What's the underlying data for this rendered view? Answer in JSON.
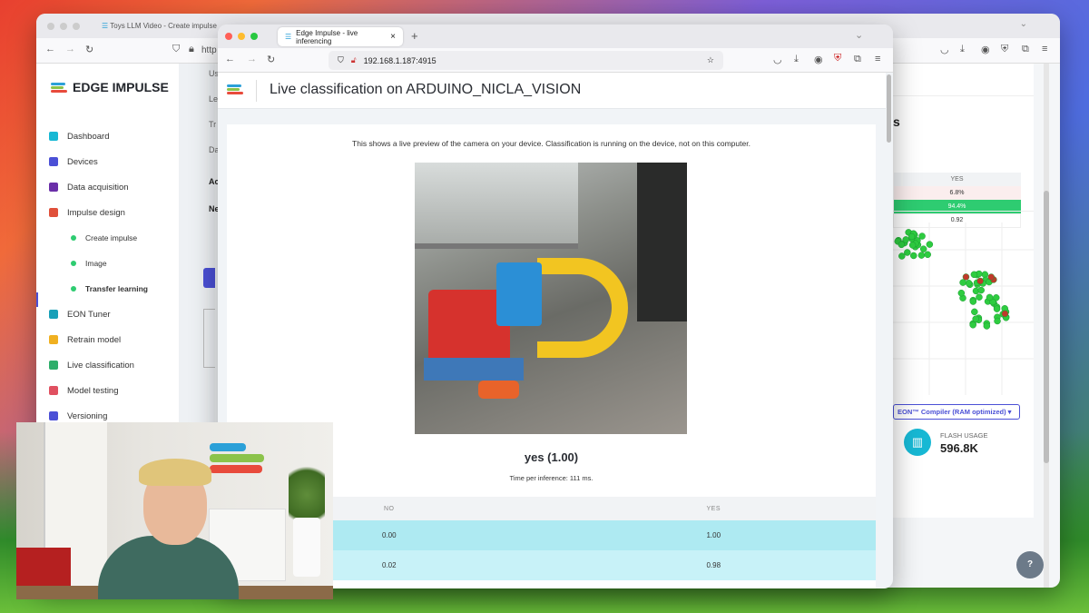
{
  "back_window": {
    "tab_title": "Toys LLM Video - Create impulse",
    "url_partial": "http",
    "logo": "EDGE IMPULSE",
    "sidebar": [
      {
        "label": "Dashboard",
        "color": "#17b8d4"
      },
      {
        "label": "Devices",
        "color": "#4b50d6"
      },
      {
        "label": "Data acquisition",
        "color": "#6a2ea8"
      },
      {
        "label": "Impulse design",
        "color": "#e0503a"
      },
      {
        "label": "Create impulse",
        "sub": true
      },
      {
        "label": "Image",
        "sub": true
      },
      {
        "label": "Transfer learning",
        "sub": true,
        "active": true
      },
      {
        "label": "EON Tuner",
        "color": "#18a0b8"
      },
      {
        "label": "Retrain model",
        "color": "#f0b020"
      },
      {
        "label": "Live classification",
        "color": "#2eae6a"
      },
      {
        "label": "Model testing",
        "color": "#e05060"
      },
      {
        "label": "Versioning",
        "color": "#4b50d6"
      }
    ],
    "partial_labels": [
      "Us",
      "Le",
      "Tr",
      "Da",
      "Ac",
      "Ne"
    ],
    "metrics_table": {
      "header": "YES",
      "rows": [
        "6.8%",
        "94.4%",
        "0.92"
      ]
    },
    "title_partial": "s",
    "compiler_select": "EON™ Compiler (RAM optimized)",
    "flash_label": "FLASH USAGE",
    "flash_value": "596.8K",
    "help": "?"
  },
  "front_window": {
    "tab_title": "Edge Impulse - live inferencing",
    "url": "192.168.1.187:4915",
    "page_title": "Live classification on ARDUINO_NICLA_VISION",
    "description": "This shows a live preview of the camera on your device. Classification is running on the device, not on this computer.",
    "result": "yes (1.00)",
    "time_per_inference": "Time per inference: 111 ms.",
    "table": {
      "headers": [
        "NO",
        "YES"
      ],
      "rows": [
        [
          "0.00",
          "1.00"
        ],
        [
          "0.02",
          "0.98"
        ]
      ]
    }
  },
  "colors": {
    "accent": "#4b50d6",
    "green": "#2ecc71",
    "cyan": "#aeeaf2"
  }
}
